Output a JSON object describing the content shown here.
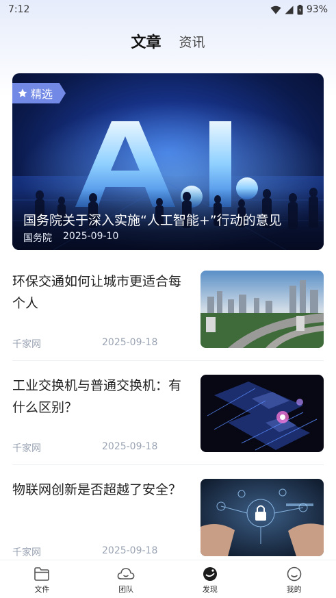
{
  "status_bar": {
    "time": "7:12",
    "battery": "93%"
  },
  "header": {
    "tabs": [
      {
        "label": "文章",
        "active": true
      },
      {
        "label": "资讯",
        "active": false
      }
    ]
  },
  "featured": {
    "badge": "精选",
    "title": "国务院关于深入实施“人工智能+”行动的意见",
    "source": "国务院",
    "date": "2025-09-10",
    "image_text": "A.I."
  },
  "articles": [
    {
      "title": "环保交通如何让城市更适合每个人",
      "source": "千家网",
      "date": "2025-09-18",
      "thumb": "city-highway"
    },
    {
      "title": "工业交换机与普通交换机：有什么区别？",
      "source": "千家网",
      "date": "2025-09-18",
      "thumb": "circuit-chip"
    },
    {
      "title": "物联网创新是否超越了安全？",
      "source": "千家网",
      "date": "2025-09-18",
      "thumb": "iot-security"
    }
  ],
  "bottom_nav": [
    {
      "label": "文件",
      "icon": "folder-icon",
      "active": false
    },
    {
      "label": "团队",
      "icon": "cloud-icon",
      "active": false
    },
    {
      "label": "发现",
      "icon": "discover-icon",
      "active": true
    },
    {
      "label": "我的",
      "icon": "smile-icon",
      "active": false
    }
  ],
  "colors": {
    "accent": "#7389e6",
    "meta_gray": "#9aa3b3"
  }
}
